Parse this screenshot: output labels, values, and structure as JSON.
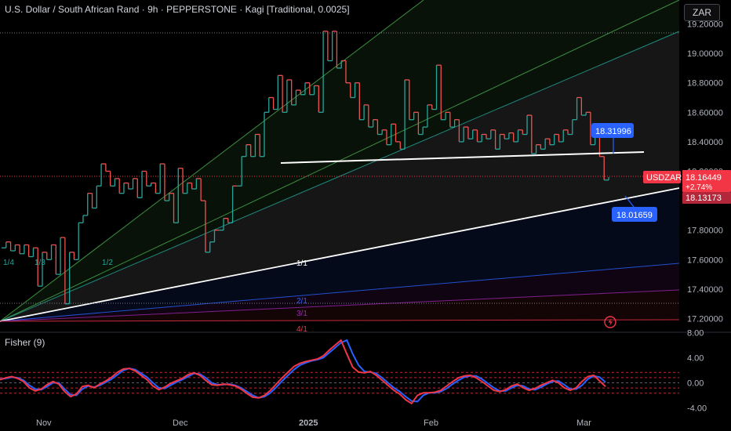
{
  "header": {
    "title": "U.S. Dollar / South African Rand · 9h · PEPPERSTONE · Kagi [Traditional, 0.0025]",
    "currency": "ZAR"
  },
  "price_badges": {
    "symbol": "USDZAR",
    "last_price": "18.16449",
    "change": "+2.74%",
    "secondary_price": "18.13173",
    "callout_upper": "18.31996",
    "callout_lower": "18.01659"
  },
  "fan_labels": [
    "1/4",
    "1/3",
    "1/2",
    "1/1",
    "2/1",
    "3/1",
    "4/1"
  ],
  "fisher": {
    "label": "Fisher (9)",
    "ticks": [
      "8.00",
      "4.00",
      "0.00",
      "-4.00"
    ]
  },
  "colors": {
    "up": "#26a69a",
    "down": "#ef5350",
    "fisher_line": "#2962ff",
    "fisher_trigger": "#f23645",
    "badge_blue": "#2962ff",
    "badge_red": "#f23645"
  },
  "chart_data": [
    {
      "type": "line",
      "subtype": "kagi",
      "title": "U.S. Dollar / South African Rand · 9h · PEPPERSTONE · Kagi [Traditional, 0.0025]",
      "y_ticks": [
        "19.20000",
        "19.00000",
        "18.80000",
        "18.60000",
        "18.40000",
        "18.20000",
        "18.00000",
        "17.80000",
        "17.60000",
        "17.40000",
        "17.20000"
      ],
      "x_ticks": [
        "Nov",
        "Dec",
        "2025",
        "Feb",
        "Mar"
      ],
      "ylim": [
        17.18,
        19.22
      ],
      "grid": false,
      "series": [
        {
          "values": [
            17.68,
            17.72,
            17.66,
            17.7,
            17.64,
            17.7,
            17.62,
            17.68,
            17.42,
            17.65,
            17.6,
            17.7,
            17.5,
            17.75,
            17.3,
            17.65,
            17.6,
            17.85,
            17.9,
            18.05,
            17.95,
            18.1,
            18.25,
            18.2,
            18.1,
            18.15,
            18.05,
            18.12,
            18.08,
            18.15,
            18.02,
            18.2,
            18.1,
            18.12,
            18.05,
            18.25,
            18.0,
            18.05,
            17.85,
            18.22,
            18.05,
            18.12,
            18.08,
            18.15,
            18.0,
            17.65,
            17.72,
            17.8,
            17.8,
            17.88,
            17.85,
            18.1,
            18.1,
            18.3,
            18.38,
            18.3,
            18.45,
            18.3,
            18.6,
            18.7,
            18.62,
            18.85,
            18.6,
            18.82,
            18.65,
            18.75,
            18.72,
            18.8,
            18.72,
            18.78,
            18.6,
            19.15,
            18.95,
            19.15,
            18.9,
            18.95,
            18.8,
            18.7,
            18.8,
            18.55,
            18.65,
            18.5,
            18.55,
            18.45,
            18.48,
            18.38,
            18.52,
            18.4,
            18.35,
            18.82,
            18.55,
            18.6,
            18.45,
            18.5,
            18.65,
            18.62,
            18.92,
            18.55,
            18.6,
            18.5,
            18.55,
            18.4,
            18.5,
            18.42,
            18.48,
            18.4,
            18.45,
            18.42,
            18.48,
            18.35,
            18.45,
            18.42,
            18.46,
            18.4,
            18.48,
            18.45,
            18.58,
            18.32,
            18.38,
            18.35,
            18.42,
            18.38,
            18.45,
            18.4,
            18.48,
            18.45,
            18.55,
            18.7,
            18.58,
            18.6,
            18.38,
            18.45,
            18.3,
            18.14,
            18.16
          ]
        }
      ],
      "lines": [
        {
          "name": "horizontal-trendline",
          "from": {
            "x": "2024-12-29",
            "y": 18.255
          },
          "to": {
            "x": "2025-03-11",
            "y": 18.32
          }
        }
      ]
    },
    {
      "type": "line",
      "title": "Fisher (9)",
      "ylim": [
        -4.6,
        8.6
      ],
      "y_ticks": [
        8,
        4,
        0,
        -4
      ],
      "levels": [
        1.5,
        0.75,
        0,
        -0.75,
        -1.5
      ],
      "series": [
        {
          "values": [
            0.5,
            0.8,
            1,
            0.7,
            0.2,
            -0.8,
            -1.3,
            -1,
            -0.3,
            0.2,
            -0.2,
            -1.4,
            -2.2,
            -1.8,
            -0.6,
            -0.4,
            -0.8,
            -0.2,
            0.3,
            0.9,
            1.7,
            2.2,
            2.3,
            1.9,
            1.2,
            0.5,
            -0.5,
            -1.1,
            -0.7,
            -0.1,
            0.3,
            0.7,
            1.3,
            1.6,
            1.2,
            0.4,
            -0.3,
            -0.4,
            -0.2,
            -0.3,
            -0.5,
            -1,
            -1.7,
            -2.3,
            -2.4,
            -2,
            -1.2,
            -0.2,
            0.8,
            1.7,
            2.6,
            3.1,
            3.4,
            3.6,
            3.8,
            4.3,
            5.2,
            6,
            6.8,
            4.6,
            2.5,
            1.7,
            1.6,
            1.8,
            1.2,
            0.4,
            -0.4,
            -1.2,
            -1.8,
            -2.7,
            -3.3,
            -2,
            -1.6,
            -1.6,
            -1.5,
            -1.2,
            -0.5,
            0.2,
            0.8,
            1.1,
            1.2,
            0.8,
            0.2,
            -0.5,
            -1.2,
            -1.4,
            -1.1,
            -0.5,
            -0.2,
            -0.8,
            -1.2,
            -0.9,
            -0.4,
            0,
            0.4,
            0,
            -0.8,
            -1.2,
            -0.8,
            0.2,
            1,
            1.2,
            0.3,
            -0.6
          ]
        },
        {
          "values": [
            0.6,
            0.7,
            0.9,
            0.8,
            0.4,
            -0.4,
            -1,
            -1.1,
            -0.6,
            0,
            0,
            -1,
            -1.9,
            -2,
            -1,
            -0.5,
            -0.7,
            -0.4,
            0.1,
            0.6,
            1.3,
            2,
            2.3,
            2.1,
            1.5,
            0.9,
            0,
            -0.8,
            -0.9,
            -0.4,
            0.1,
            0.5,
            1,
            1.5,
            1.4,
            0.8,
            0,
            -0.3,
            -0.3,
            -0.2,
            -0.4,
            -0.8,
            -1.4,
            -2,
            -2.4,
            -2.2,
            -1.6,
            -0.7,
            0.3,
            1.2,
            2.1,
            2.8,
            3.2,
            3.5,
            3.7,
            4,
            4.8,
            5.6,
            6.4,
            6.8,
            4.6,
            2.8,
            1.8,
            1.7,
            1.5,
            0.8,
            0,
            -0.8,
            -1.4,
            -2.2,
            -2.9,
            -3,
            -2,
            -1.6,
            -1.6,
            -1.4,
            -0.9,
            -0.2,
            0.4,
            0.9,
            1.1,
            1.1,
            0.6,
            -0.1,
            -0.8,
            -1.3,
            -1.3,
            -0.8,
            -0.4,
            -0.5,
            -1,
            -1.1,
            -0.7,
            -0.2,
            0.2,
            0.3,
            -0.3,
            -1,
            -1,
            -0.4,
            0.6,
            1.1,
            0.9,
            0.1
          ]
        }
      ]
    }
  ]
}
